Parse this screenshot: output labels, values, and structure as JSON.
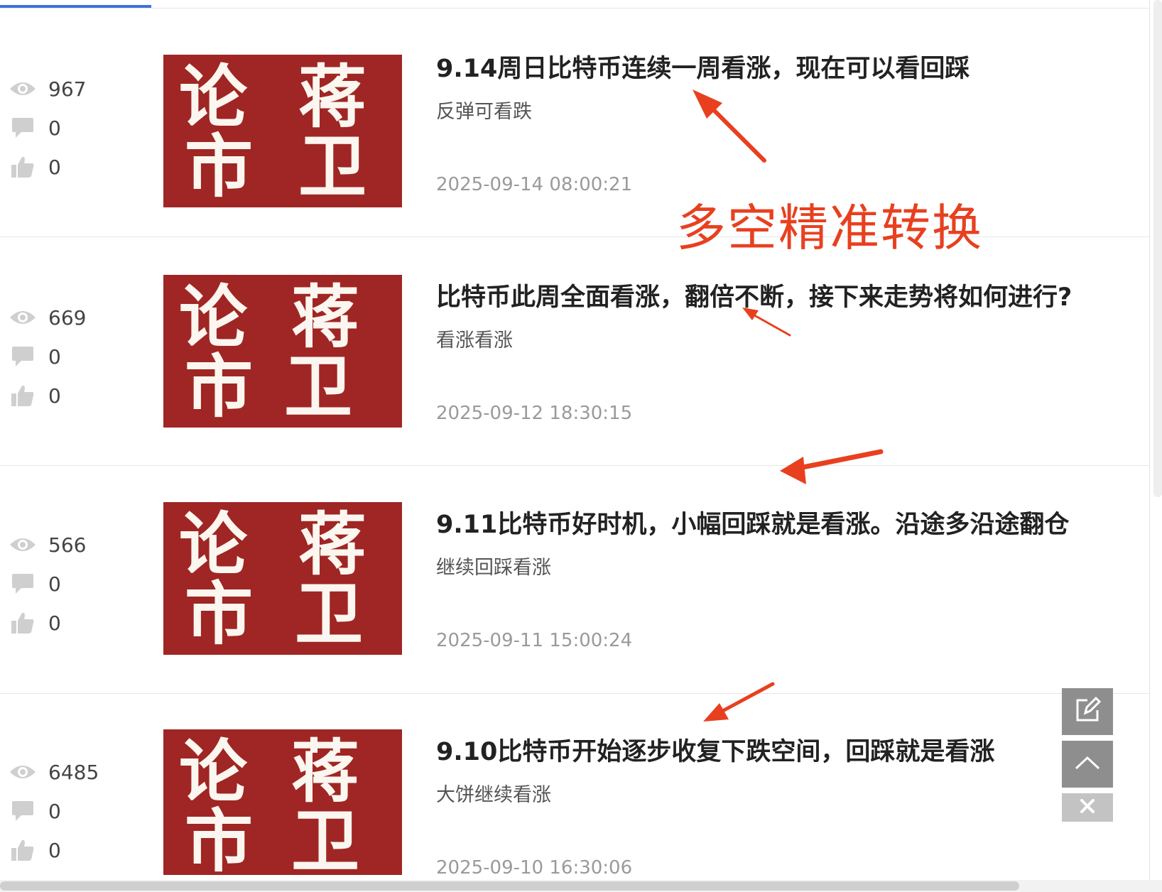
{
  "articles": [
    {
      "views": "967",
      "comments": "0",
      "likes": "0",
      "title": "9.14周日比特币连续一周看涨，现在可以看回踩",
      "summary": "反弹可看跌",
      "date": "2025-09-14 08:00:21"
    },
    {
      "views": "669",
      "comments": "0",
      "likes": "0",
      "title": "比特币此周全面看涨，翻倍不断，接下来走势将如何进行?",
      "summary": "看涨看涨",
      "date": "2025-09-12 18:30:15"
    },
    {
      "views": "566",
      "comments": "0",
      "likes": "0",
      "title": "9.11比特币好时机，小幅回踩就是看涨。沿途多沿途翻仓",
      "summary": "继续回踩看涨",
      "date": "2025-09-11 15:00:24"
    },
    {
      "views": "6485",
      "comments": "0",
      "likes": "0",
      "title": "9.10比特币开始逐步收复下跌空间，回踩就是看涨",
      "summary": "大饼继续看涨",
      "date": "2025-09-10 16:30:06"
    }
  ],
  "thumbnail": {
    "chars": [
      "论",
      "蒋",
      "市",
      "卫"
    ],
    "background": "#9f2624"
  },
  "annotation": {
    "text": "多空精准转换",
    "color": "#e8401f"
  },
  "floating_buttons": [
    {
      "icon": "edit-icon"
    },
    {
      "icon": "chevron-up-icon"
    },
    {
      "icon": "close-icon"
    }
  ],
  "colors": {
    "accent": "#3b74d8",
    "title": "#222222",
    "date": "#9a9a9a"
  }
}
